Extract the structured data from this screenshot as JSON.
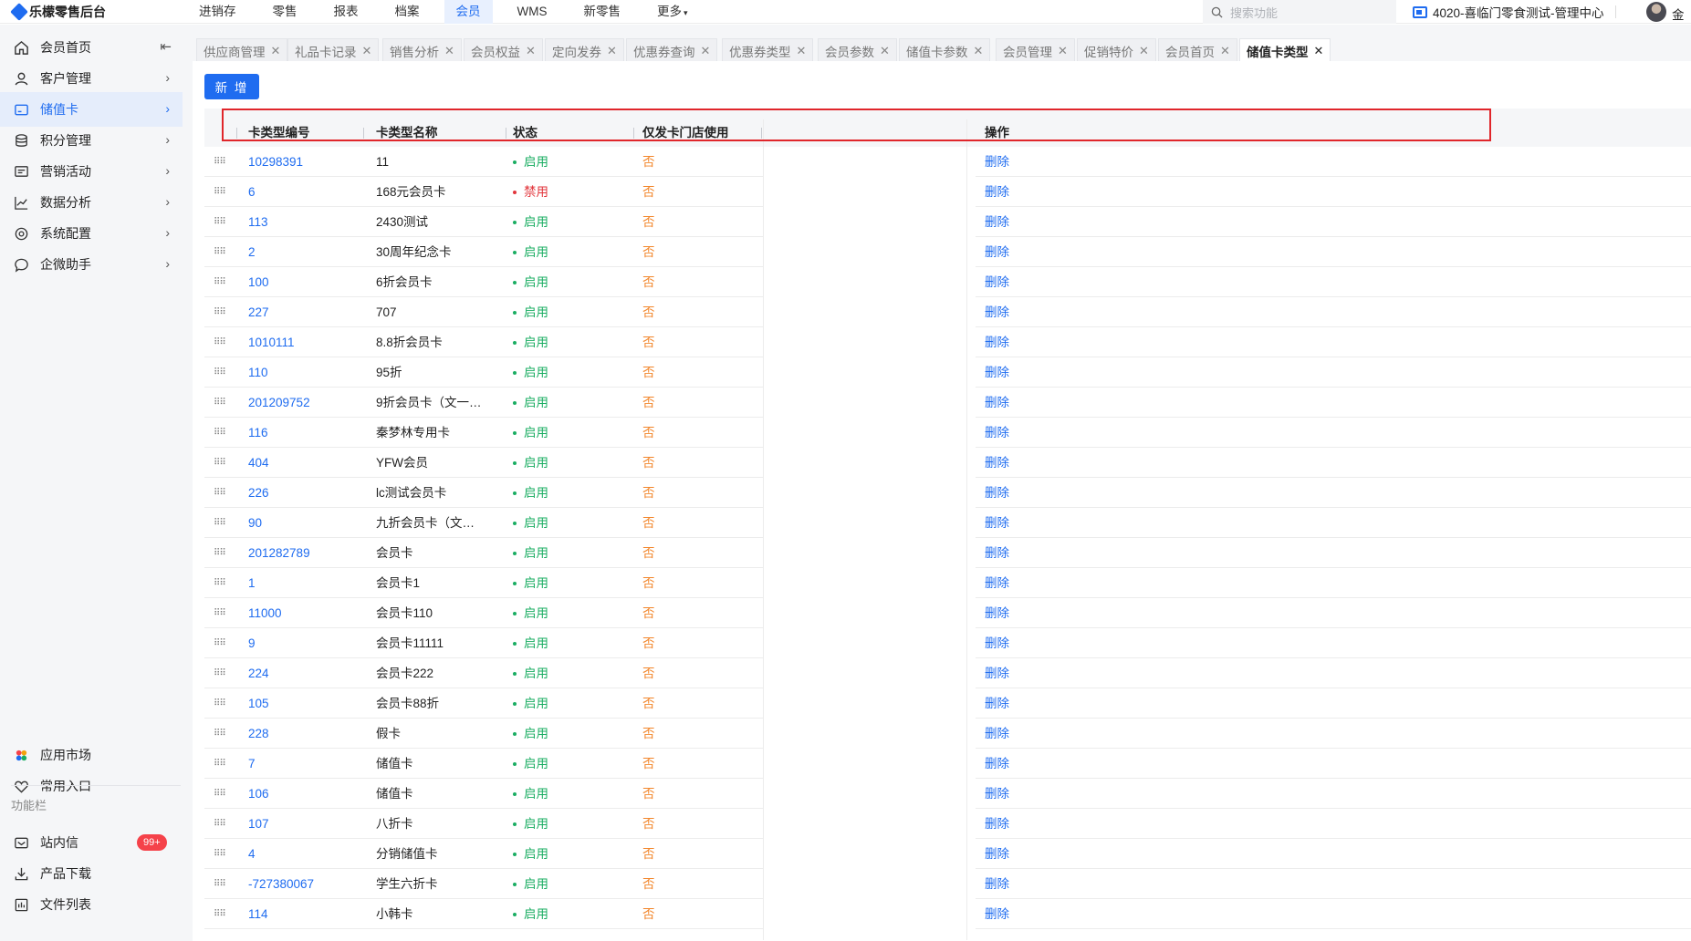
{
  "app": {
    "logo_text": "乐檬零售后台"
  },
  "topnav": {
    "items": [
      "进销存",
      "零售",
      "报表",
      "档案",
      "会员",
      "WMS",
      "新零售",
      "更多"
    ],
    "active": "会员",
    "more_caret": "▾"
  },
  "search": {
    "placeholder": "搜索功能"
  },
  "store": {
    "name": "4020-喜临门零食测试-管理中心"
  },
  "user": {
    "name": "金"
  },
  "sidebar": {
    "items": [
      {
        "label": "会员首页",
        "icon": "home-icon"
      },
      {
        "label": "客户管理",
        "icon": "user-icon"
      },
      {
        "label": "储值卡",
        "icon": "card-icon"
      },
      {
        "label": "积分管理",
        "icon": "database-icon"
      },
      {
        "label": "营销活动",
        "icon": "campaign-icon"
      },
      {
        "label": "数据分析",
        "icon": "chart-line-icon"
      },
      {
        "label": "系统配置",
        "icon": "settings-icon"
      },
      {
        "label": "企微助手",
        "icon": "chat-icon"
      }
    ],
    "active": "储值卡",
    "bottom_items": [
      {
        "label": "应用市场",
        "icon": "app-market-icon"
      },
      {
        "label": "常用入口",
        "icon": "heart-icon"
      }
    ],
    "section_title": "功能栏",
    "tool_items": [
      {
        "label": "站内信",
        "icon": "message-icon",
        "badge": "99+"
      },
      {
        "label": "产品下载",
        "icon": "download-icon"
      },
      {
        "label": "文件列表",
        "icon": "file-list-icon"
      }
    ]
  },
  "tabs": [
    "供应商管理",
    "礼品卡记录",
    "销售分析",
    "会员权益",
    "定向发券",
    "优惠券查询",
    "优惠券类型",
    "会员参数",
    "储值卡参数",
    "会员管理",
    "促销特价",
    "会员首页",
    "储值卡类型"
  ],
  "active_tab": "储值卡类型",
  "toolbar": {
    "add_label": "新 增"
  },
  "table": {
    "columns": [
      "卡类型编号",
      "卡类型名称",
      "状态",
      "仅发卡门店使用",
      "操作"
    ],
    "rows": [
      {
        "id": "10298391",
        "name": "11",
        "status": "启用",
        "store_only": "否",
        "op": "删除"
      },
      {
        "id": "6",
        "name": "168元会员卡",
        "status": "禁用",
        "store_only": "否",
        "op": "删除"
      },
      {
        "id": "113",
        "name": "2430测试",
        "status": "启用",
        "store_only": "否",
        "op": "删除"
      },
      {
        "id": "2",
        "name": "30周年纪念卡",
        "status": "启用",
        "store_only": "否",
        "op": "删除"
      },
      {
        "id": "100",
        "name": "6折会员卡",
        "status": "启用",
        "store_only": "否",
        "op": "删除"
      },
      {
        "id": "227",
        "name": "707",
        "status": "启用",
        "store_only": "否",
        "op": "删除"
      },
      {
        "id": "1010111",
        "name": "8.8折会员卡",
        "status": "启用",
        "store_only": "否",
        "op": "删除"
      },
      {
        "id": "110",
        "name": "95折",
        "status": "启用",
        "store_only": "否",
        "op": "删除"
      },
      {
        "id": "201209752",
        "name": "9折会员卡（文一…",
        "status": "启用",
        "store_only": "否",
        "op": "删除"
      },
      {
        "id": "116",
        "name": "秦梦林专用卡",
        "status": "启用",
        "store_only": "否",
        "op": "删除"
      },
      {
        "id": "404",
        "name": "YFW会员",
        "status": "启用",
        "store_only": "否",
        "op": "删除"
      },
      {
        "id": "226",
        "name": "lc测试会员卡",
        "status": "启用",
        "store_only": "否",
        "op": "删除"
      },
      {
        "id": "90",
        "name": "九折会员卡（文…",
        "status": "启用",
        "store_only": "否",
        "op": "删除"
      },
      {
        "id": "201282789",
        "name": "会员卡",
        "status": "启用",
        "store_only": "否",
        "op": "删除"
      },
      {
        "id": "1",
        "name": "会员卡1",
        "status": "启用",
        "store_only": "否",
        "op": "删除"
      },
      {
        "id": "11000",
        "name": "会员卡110",
        "status": "启用",
        "store_only": "否",
        "op": "删除"
      },
      {
        "id": "9",
        "name": "会员卡11111",
        "status": "启用",
        "store_only": "否",
        "op": "删除"
      },
      {
        "id": "224",
        "name": "会员卡222",
        "status": "启用",
        "store_only": "否",
        "op": "删除"
      },
      {
        "id": "105",
        "name": "会员卡88折",
        "status": "启用",
        "store_only": "否",
        "op": "删除"
      },
      {
        "id": "228",
        "name": "假卡",
        "status": "启用",
        "store_only": "否",
        "op": "删除"
      },
      {
        "id": "7",
        "name": "储值卡",
        "status": "启用",
        "store_only": "否",
        "op": "删除"
      },
      {
        "id": "106",
        "name": "储值卡",
        "status": "启用",
        "store_only": "否",
        "op": "删除"
      },
      {
        "id": "107",
        "name": "八折卡",
        "status": "启用",
        "store_only": "否",
        "op": "删除"
      },
      {
        "id": "4",
        "name": "分销储值卡",
        "status": "启用",
        "store_only": "否",
        "op": "删除"
      },
      {
        "id": "-727380067",
        "name": "学生六折卡",
        "status": "启用",
        "store_only": "否",
        "op": "删除"
      },
      {
        "id": "114",
        "name": "小韩卡",
        "status": "启用",
        "store_only": "否",
        "op": "删除"
      }
    ]
  },
  "colors": {
    "accent": "#1f6cf0",
    "enabled": "#1aad62",
    "disabled": "#e2363c",
    "no": "#f2862b",
    "highlight_box": "#e0262b"
  }
}
